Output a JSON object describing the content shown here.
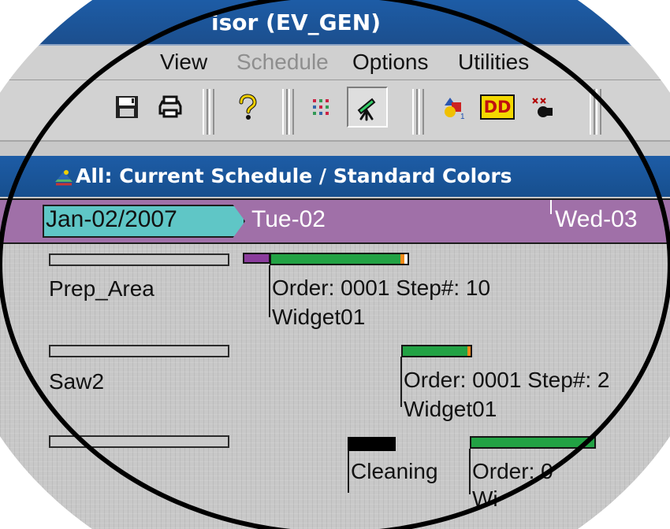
{
  "titlebar": {
    "title": "isor (EV_GEN)"
  },
  "menu": {
    "view": "View",
    "schedule": "Schedule",
    "options": "Options",
    "utilities": "Utilities"
  },
  "toolbar": {
    "icons": [
      "save-icon",
      "printer-icon",
      "help-icon",
      "grid-icon",
      "telescope-icon",
      "shapes-icon",
      "dd-icon",
      "bug-icon"
    ],
    "dd_label": "DD"
  },
  "window": {
    "title": "All: Current Schedule / Standard Colors"
  },
  "timeline": {
    "date": "Jan-02/2007",
    "days": [
      "Tue-02",
      "Wed-03"
    ]
  },
  "resources": [
    {
      "name": "Prep_Area",
      "order_text": "Order: 0001  Step#: 10",
      "item": "Widget01"
    },
    {
      "name": "Saw2",
      "order_text": "Order: 0001  Step#: 2",
      "item": "Widget01"
    },
    {
      "name": "",
      "cleaning": "Cleaning",
      "order_text": "Order: 0",
      "item": "Wi"
    }
  ],
  "colors": {
    "title_blue": "#1d5ca6",
    "timeline_purple": "#a070a8",
    "date_cyan": "#5fc6c6",
    "task_green": "#22a244",
    "task_orange": "#f08a1a",
    "task_blue": "#2b66bb"
  }
}
